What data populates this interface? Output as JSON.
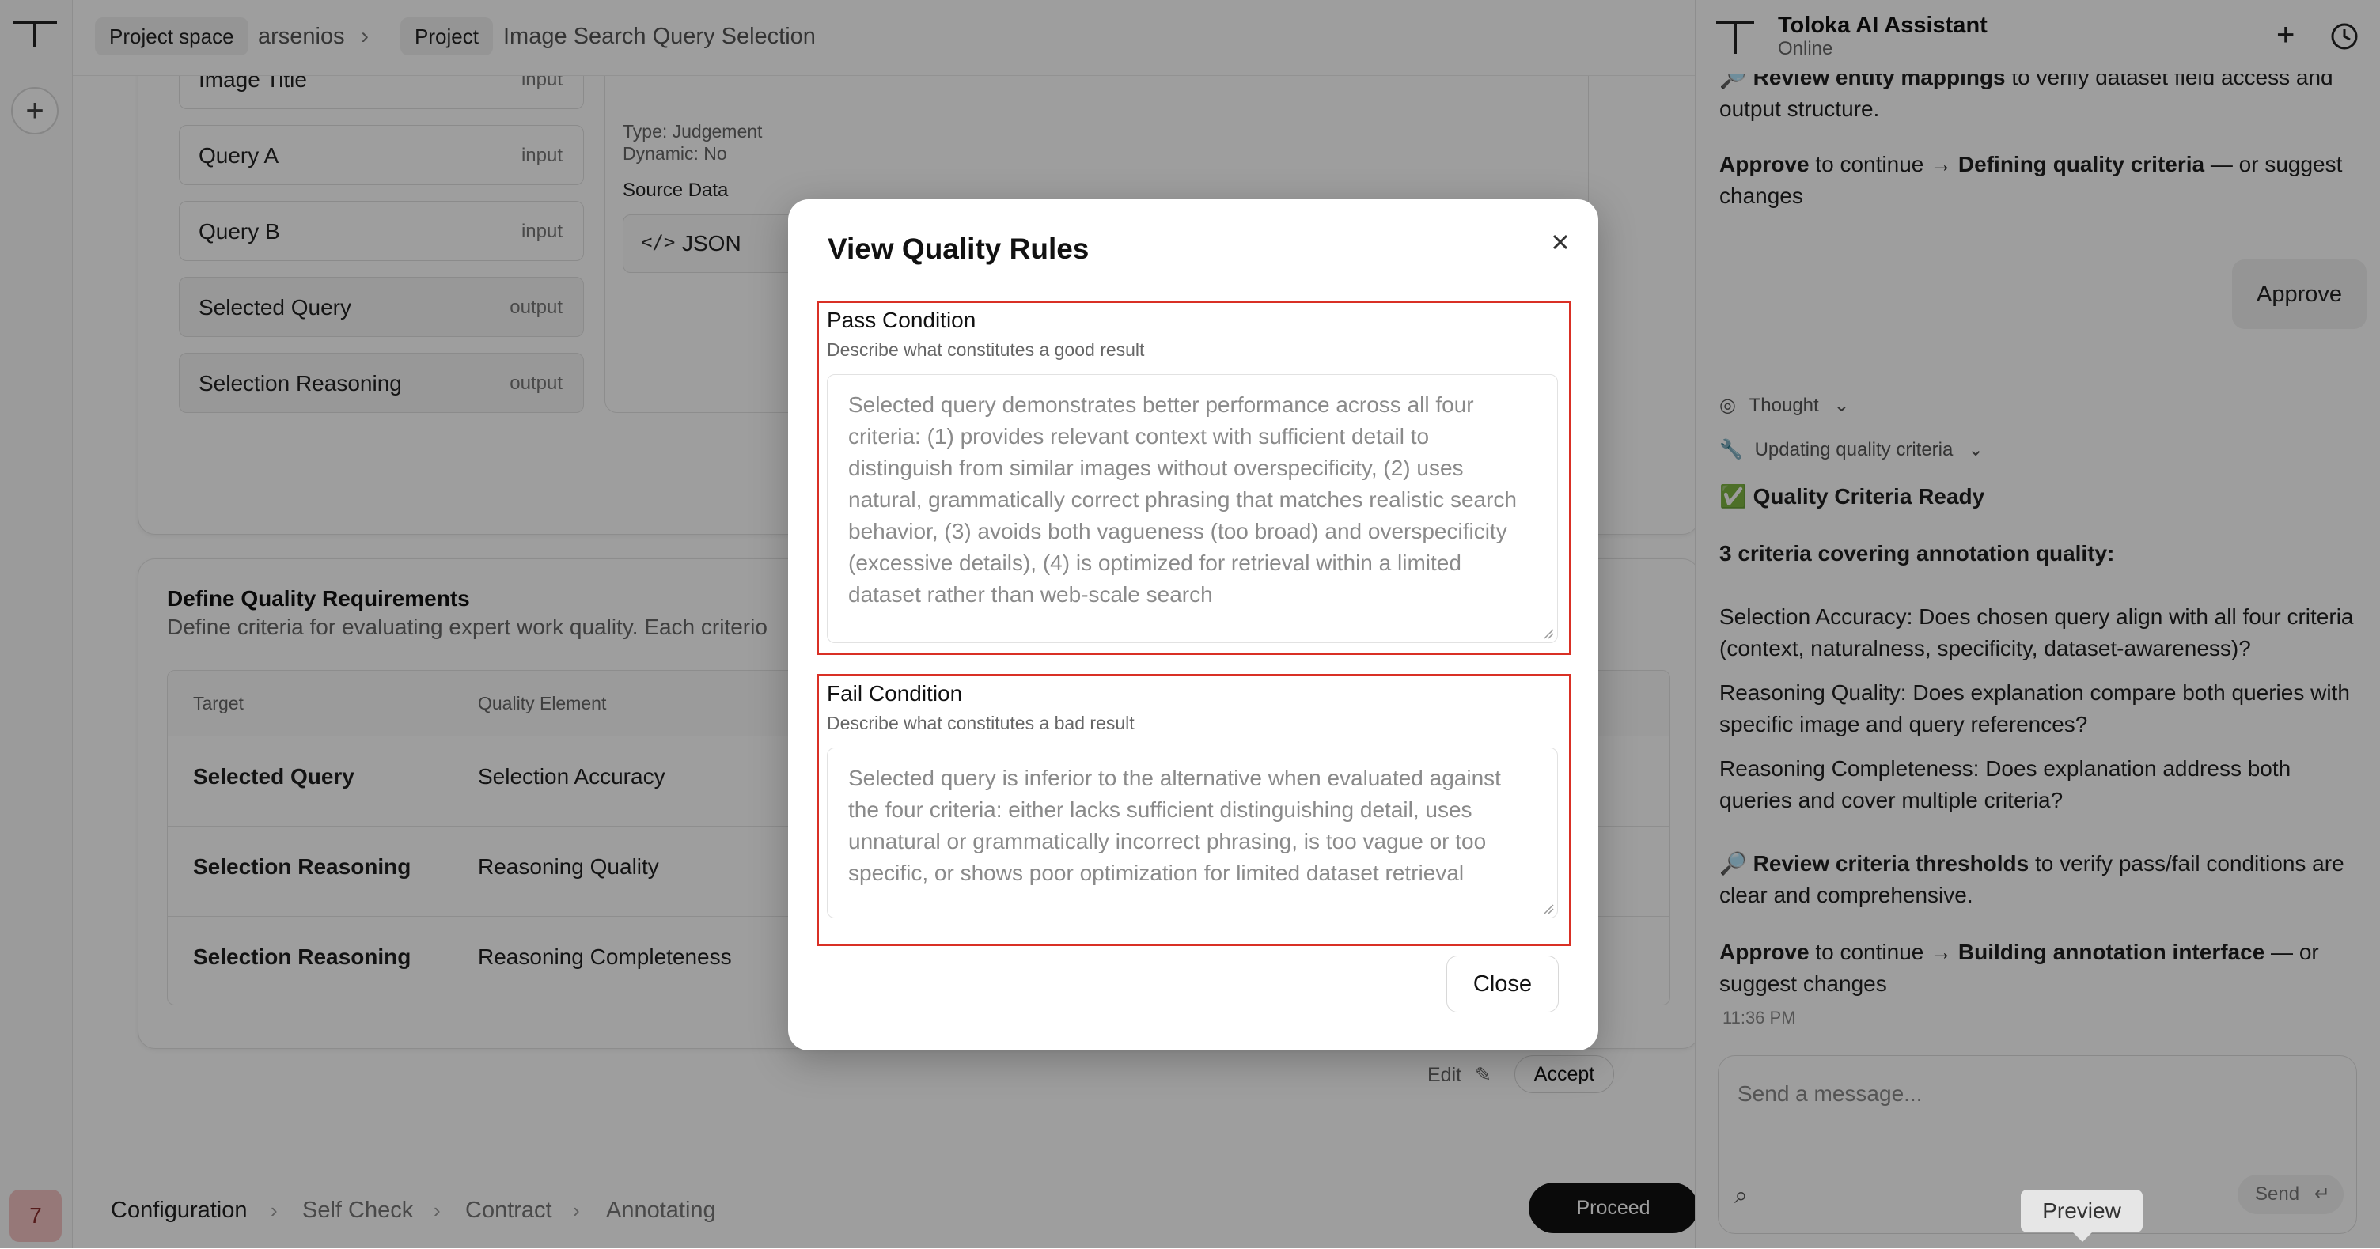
{
  "header": {
    "crumb_project_space": "Project space",
    "crumb_user": "arsenios",
    "crumb_project": "Project",
    "crumb_title": "Image Search Query Selection",
    "separator": "›"
  },
  "rail": {
    "plus": "+",
    "avatar": "7"
  },
  "fields": [
    {
      "name": "Image Title",
      "kind": "input"
    },
    {
      "name": "Query A",
      "kind": "input"
    },
    {
      "name": "Query B",
      "kind": "input"
    },
    {
      "name": "Selected Query",
      "kind": "output"
    },
    {
      "name": "Selection Reasoning",
      "kind": "output"
    }
  ],
  "field_detail": {
    "type": "Type: Judgement",
    "dynamic": "Dynamic: No",
    "source_label": "Source Data",
    "source_value": "JSON"
  },
  "quality_section": {
    "title": "Define Quality Requirements",
    "subtitle": "Define criteria for evaluating expert work quality. Each criterio",
    "col_target": "Target",
    "col_element": "Quality Element",
    "rows": [
      {
        "target": "Selected Query",
        "element": "Selection Accuracy"
      },
      {
        "target": "Selection Reasoning",
        "element": "Reasoning Quality"
      },
      {
        "target": "Selection Reasoning",
        "element": "Reasoning Completeness"
      }
    ],
    "edit_label": "Edit",
    "accept_label": "Accept"
  },
  "steps": {
    "items": [
      "Configuration",
      "Self Check",
      "Contract",
      "Annotating"
    ],
    "active": "Configuration",
    "proceed_label": "Proceed"
  },
  "chat": {
    "title": "Toloka AI Assistant",
    "status": "Online",
    "msg1_bold": "Review entity mappings",
    "msg1_rest": " to verify dataset field access and output structure.",
    "msg2_approve": "Approve",
    "msg2_mid": " to continue → ",
    "msg2_target": "Defining quality criteria",
    "msg2_rest": " — or suggest changes",
    "approve_button": "Approve",
    "thought_label": "Thought",
    "updating_label": "Updating quality criteria",
    "ready_emoji": "✅",
    "ready_title": "Quality Criteria Ready",
    "criteria_heading": "3 criteria covering annotation quality:",
    "criteria": [
      "Selection Accuracy: Does chosen query align with all four criteria (context, naturalness, specificity, dataset-awareness)?",
      "Reasoning Quality: Does explanation compare both queries with specific image and query references?",
      "Reasoning Completeness: Does explanation address both queries and cover multiple criteria?"
    ],
    "review_emoji": "🔎",
    "review_bold": "Review criteria thresholds",
    "review_rest": " to verify pass/fail conditions are clear and comprehensive.",
    "msg3_approve": "Approve",
    "msg3_mid": " to continue → ",
    "msg3_target": "Building annotation interface",
    "msg3_rest": " — or suggest changes",
    "timestamp": "11:36 PM",
    "input_placeholder": "Send a message...",
    "send_label": "Send"
  },
  "modal": {
    "title": "View Quality Rules",
    "pass_label": "Pass Condition",
    "pass_help": "Describe what constitutes a good result",
    "pass_text": "Selected query demonstrates better performance across all four criteria: (1) provides relevant context with sufficient detail to distinguish from similar images without overspecificity, (2) uses natural, grammatically correct phrasing that matches realistic search behavior, (3) avoids both vagueness (too broad) and overspecificity (excessive details), (4) is optimized for retrieval within a limited dataset rather than web-scale search",
    "fail_label": "Fail Condition",
    "fail_help": "Describe what constitutes a bad result",
    "fail_text": "Selected query is inferior to the alternative when evaluated against the four criteria: either lacks sufficient distinguishing detail, uses unnatural or grammatically incorrect phrasing, is too vague or too specific, or shows poor optimization for limited dataset retrieval",
    "close_label": "Close"
  },
  "tooltip": {
    "preview": "Preview"
  },
  "colors": {
    "highlight": "#d93025",
    "overlay": "rgba(0,0,0,0.38)",
    "proceed_bg": "#111111"
  }
}
